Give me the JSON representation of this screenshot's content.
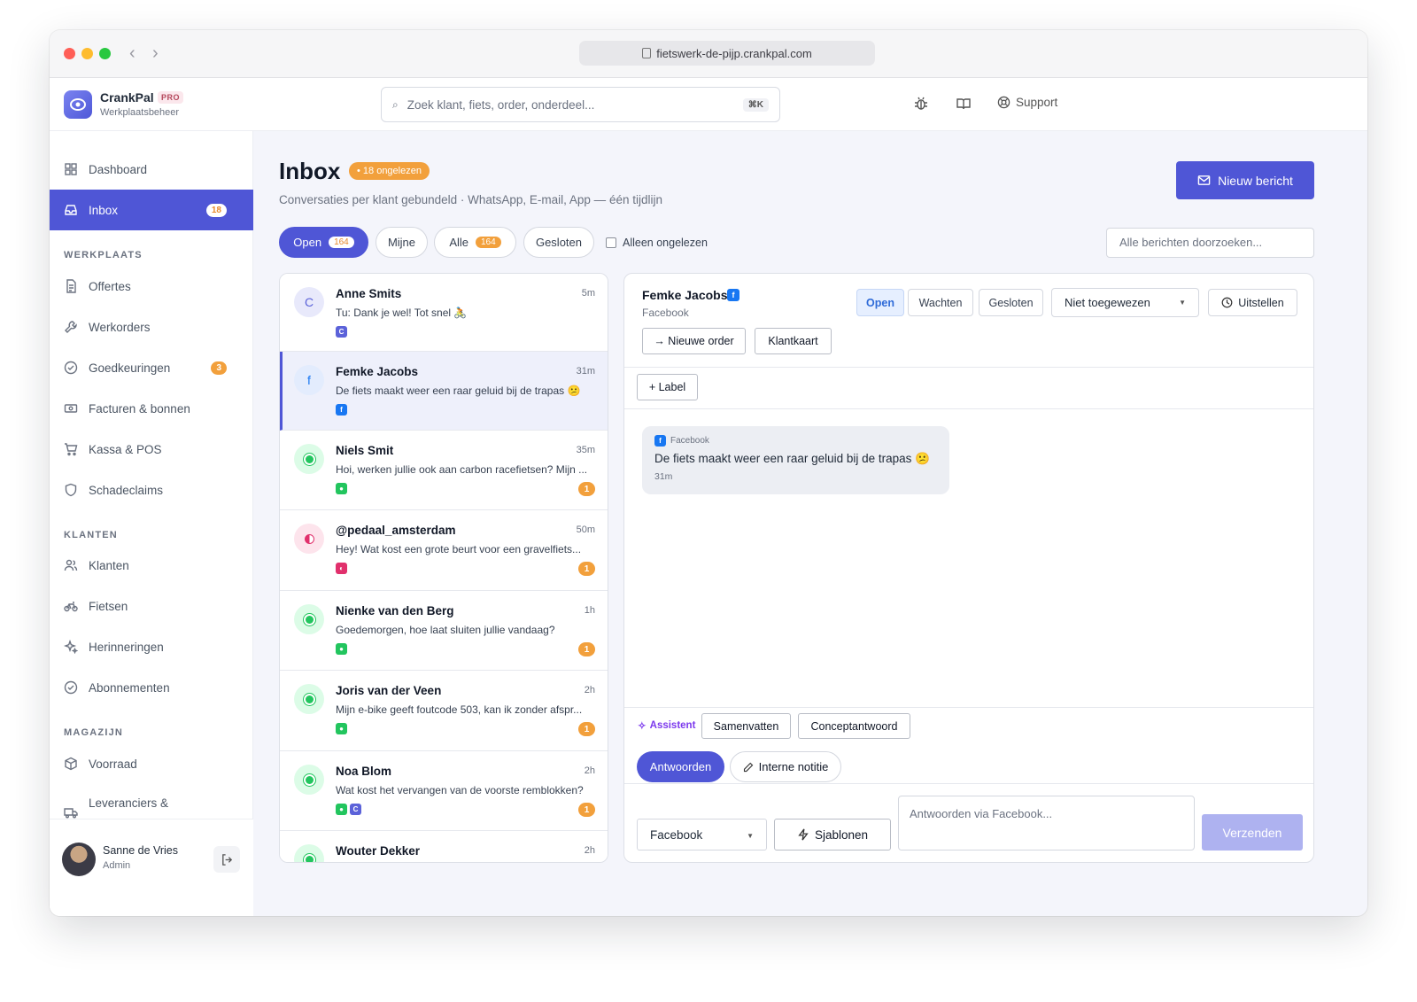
{
  "browser": {
    "url": "fietswerk-de-pijp.crankpal.com"
  },
  "brand": {
    "name": "CrankPal",
    "badge": "PRO",
    "subtitle": "Werkplaatsbeheer"
  },
  "header": {
    "search_placeholder": "Zoek klant, fiets, order, onderdeel...",
    "search_shortcut": "⌘K",
    "support_label": "Support"
  },
  "sidebar": {
    "items": [
      {
        "label": "Dashboard"
      },
      {
        "label": "Inbox",
        "badge": "18"
      }
    ],
    "sections": {
      "werkplaats": {
        "title": "WERKPLAATS",
        "items": [
          {
            "label": "Offertes"
          },
          {
            "label": "Werkorders"
          },
          {
            "label": "Goedkeuringen",
            "badge": "3"
          },
          {
            "label": "Facturen & bonnen"
          },
          {
            "label": "Kassa & POS"
          },
          {
            "label": "Schadeclaims"
          }
        ]
      },
      "klanten": {
        "title": "KLANTEN",
        "items": [
          {
            "label": "Klanten"
          },
          {
            "label": "Fietsen"
          },
          {
            "label": "Herinneringen"
          },
          {
            "label": "Abonnementen"
          }
        ]
      },
      "magazijn": {
        "title": "MAGAZIJN",
        "items": [
          {
            "label": "Voorraad"
          },
          {
            "label": "Leveranciers &"
          }
        ]
      }
    },
    "user": {
      "name": "Sanne de Vries",
      "role": "Admin"
    }
  },
  "page": {
    "title": "Inbox",
    "unread_pill": "• 18 ongelezen",
    "subtitle": "Conversaties per klant gebundeld · WhatsApp, E-mail, App — één tijdlijn",
    "new_message_label": "Nieuw bericht",
    "filters": [
      {
        "label": "Open",
        "count": "164"
      },
      {
        "label": "Mijne"
      },
      {
        "label": "Alle",
        "count": "164"
      },
      {
        "label": "Gesloten"
      }
    ],
    "unread_only_label": "Alleen ongelezen",
    "search_placeholder": "Alle berichten doorzoeken..."
  },
  "conversations": [
    {
      "initial": "C",
      "name": "Anne Smits",
      "time": "5m",
      "preview": "Tu: Dank je wel! Tot snel 🚴",
      "channel": "C"
    },
    {
      "initial": "f",
      "name": "Femke Jacobs",
      "time": "31m",
      "preview": "De fiets maakt weer een raar geluid bij de trapas 😕",
      "channel": "f"
    },
    {
      "name": "Niels Smit",
      "time": "35m",
      "preview": "Hoi, werken jullie ook aan carbon racefietsen? Mijn ...",
      "count": "1"
    },
    {
      "name": "@pedaal_amsterdam",
      "time": "50m",
      "preview": "Hey! Wat kost een grote beurt voor een gravelfiets...",
      "count": "1"
    },
    {
      "name": "Nienke van den Berg",
      "time": "1h",
      "preview": "Goedemorgen, hoe laat sluiten jullie vandaag?",
      "count": "1"
    },
    {
      "name": "Joris van der Veen",
      "time": "2h",
      "preview": "Mijn e-bike geeft foutcode 503, kan ik zonder afspr...",
      "count": "1"
    },
    {
      "name": "Noa Blom",
      "time": "2h",
      "preview": "Wat kost het vervangen van de voorste remblokken?",
      "count": "1",
      "channel2": "C"
    },
    {
      "name": "Wouter Dekker",
      "time": "2h"
    }
  ],
  "detail": {
    "name": "Femke Jacobs",
    "channel_mark": "f",
    "channel": "Facebook",
    "status_buttons": [
      "Open",
      "Wachten",
      "Gesloten"
    ],
    "assignee": "Niet toegewezen",
    "postpone_label": "Uitstellen",
    "actions": [
      "→ Nieuwe order",
      "Klantkaart"
    ],
    "label_button": "+ Label",
    "message": {
      "channel": "Facebook",
      "text": "De fiets maakt weer een raar geluid bij de trapas 😕",
      "time": "31m"
    },
    "assistant_label": "Assistent",
    "assistant_buttons": [
      "Samenvatten",
      "Conceptantwoord"
    ],
    "tabs": [
      "Antwoorden",
      "Interne notitie"
    ],
    "reply_channel": "Facebook",
    "templates_label": "Sjablonen",
    "reply_placeholder": "Antwoorden via Facebook...",
    "send_label": "Verzenden"
  },
  "colors": {
    "accent": "#4f56d6",
    "badge": "#f2a03c",
    "facebook": "#1877f2",
    "whatsapp": "#22c55e",
    "instagram": "#e1306c"
  }
}
